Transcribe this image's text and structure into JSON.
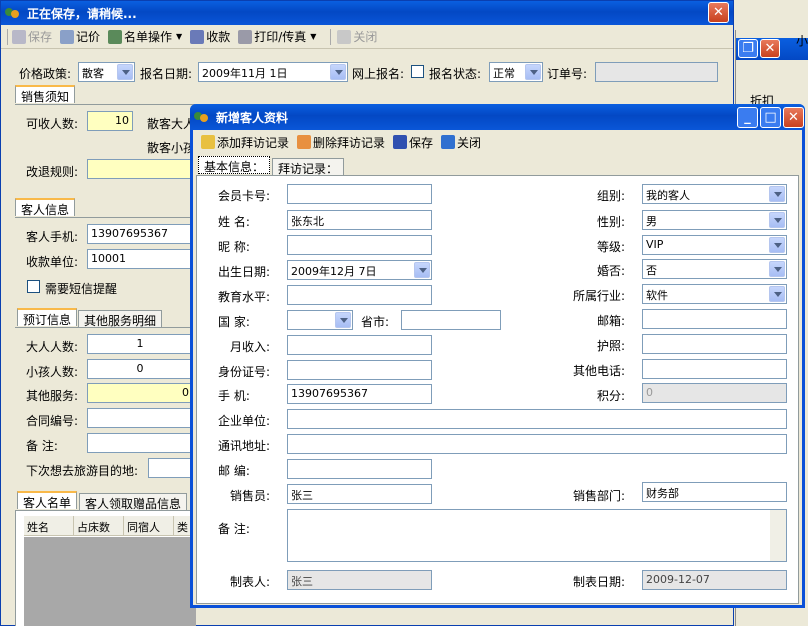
{
  "main": {
    "title": "正在保存，请稍候...",
    "toolbar": {
      "save": "保存",
      "price": "记价",
      "name_ops": "名单操作",
      "receipt": "收款",
      "print_fax": "打印/传真",
      "close": "关闭"
    },
    "filter": {
      "price_policy_label": "价格政策:",
      "price_policy_value": "散客",
      "reg_date_label": "报名日期:",
      "reg_date_value": "2009年11月 1日",
      "online_label": "网上报名:",
      "status_label": "报名状态:",
      "status_value": "正常",
      "order_label": "订单号:"
    },
    "sales_tab": "销售须知",
    "receivable_label": "可收人数:",
    "receivable_value": "10",
    "adult_label": "散客大人",
    "child_label": "散客小孩",
    "refund_label": "改退规则:",
    "guest_tab": "客人信息",
    "mobile_label": "客人手机:",
    "mobile_value": "13907695367",
    "unit_label": "收款单位:",
    "unit_value": "10001",
    "sms_label": "需要短信提醒",
    "tabs2": [
      "预订信息",
      "其他服务明细"
    ],
    "adults_label": "大人人数:",
    "adults_value": "1",
    "children_label": "小孩人数:",
    "children_value": "0",
    "other_label": "其他服务:",
    "other_value": "0",
    "contract_label": "合同编号:",
    "remark_label": "备    注:",
    "next_label": "下次想去旅游目的地:",
    "tabs3": [
      "客人名单",
      "客人领取赠品信息"
    ],
    "columns": [
      "姓名",
      "占床数",
      "同宿人",
      "类"
    ]
  },
  "right_partial": {
    "tab_text": "折扣",
    "corner_text": "小"
  },
  "dialog": {
    "title": "新增客人资料",
    "toolbar": {
      "add": "添加拜访记录",
      "delete": "删除拜访记录",
      "save": "保存",
      "close": "关闭"
    },
    "tabs": [
      "基本信息：",
      "拜访记录："
    ],
    "fields": {
      "card_label": "会员卡号:",
      "card_value": "",
      "name_label": "姓    名:",
      "name_value": "张东北",
      "nick_label": "昵    称:",
      "birth_label": "出生日期:",
      "birth_value": "2009年12月 7日",
      "edu_label": "教育水平:",
      "country_label": "国    家:",
      "province_label": "省市:",
      "income_label": "月收入:",
      "id_label": "身份证号:",
      "phone_label": "手    机:",
      "phone_value": "13907695367",
      "company_label": "企业单位:",
      "address_label": "通讯地址:",
      "zip_label": "邮    编:",
      "seller_label": "销售员:",
      "seller_value": "张三",
      "note_label": "备    注:",
      "maker_label": "制表人:",
      "maker_value": "张三",
      "group_label": "组别:",
      "group_value": "我的客人",
      "gender_label": "性别:",
      "gender_value": "男",
      "level_label": "等级:",
      "level_value": "VIP",
      "marital_label": "婚否:",
      "marital_value": "否",
      "industry_label": "所属行业:",
      "industry_value": "软件",
      "email_label": "邮箱:",
      "passport_label": "护照:",
      "other_phone_label": "其他电话:",
      "points_label": "积分:",
      "points_value": "0",
      "dept_label": "销售部门:",
      "dept_value": "财务部",
      "date_label": "制表日期:",
      "date_value": "2009-12-07"
    }
  }
}
